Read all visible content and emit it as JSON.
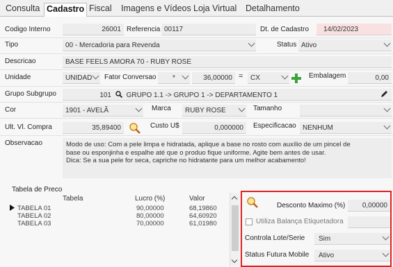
{
  "tabs": [
    "Consulta",
    "Cadastro",
    "Fiscal",
    "Imagens e Vídeos",
    "Loja Virtual",
    "Detalhamento"
  ],
  "active_tab": "Cadastro",
  "form": {
    "codigo_label": "Codigo Interno",
    "codigo_value": "26001",
    "referencia_label": "Referencia",
    "referencia_value": "00117",
    "dt_cadastro_label": "Dt. de Cadastro",
    "dt_cadastro_value": "14/02/2023",
    "tipo_label": "Tipo",
    "tipo_value": "00 - Mercadoria para Revenda",
    "status_label": "Status",
    "status_value": "Ativo",
    "descricao_label": "Descricao",
    "descricao_value": "BASE FEELS AMORA 70 - RUBY ROSE",
    "unidade_label": "Unidade",
    "unidade_value": "UNIDAD",
    "fator_label": "Fator Conversao",
    "fator_op": "*",
    "fator_value": "36,00000",
    "equals": "=",
    "cx_value": "CX",
    "embalagem_label": "Embalagem",
    "embalagem_value": "0,00",
    "grupo_label": "Grupo Subgrupo",
    "grupo_code": "101",
    "grupo_value": "GRUPO 1.1 -> GRUPO 1 -> DEPARTAMENTO 1",
    "cor_label": "Cor",
    "cor_value": "1901 - AVELÃ",
    "marca_label": "Marca",
    "marca_value": "RUBY ROSE",
    "tamanho_label": "Tamanho",
    "tamanho_value": "",
    "ult_compra_label": "Ult. Vl. Compra",
    "ult_compra_value": "35,89400",
    "custo_label": "Custo U$",
    "custo_value": "0,000000",
    "especificacao_label": "Especificacao",
    "especificacao_value": "NENHUM",
    "observacao_label": "Observacao",
    "observacao_lines": [
      "Modo de uso: Com a pele limpa e hidratada, aplique a base no rosto com auxílio de um pincel de",
      "base ou esponjinha e espalhe até que o produo fique uniforme. Agite bem antes de usar.",
      "Dica: Se a sua pele for seca, capriche no hidratante para um melhor acabamento!"
    ]
  },
  "price_table": {
    "title": "Tabela de Preco",
    "headers": [
      "Tabela",
      "Lucro (%)",
      "Valor"
    ],
    "rows": [
      {
        "tabela": "TABELA 01",
        "lucro": "90,00000",
        "valor": "68,19860"
      },
      {
        "tabela": "TABELA 02",
        "lucro": "80,00000",
        "valor": "64,60920"
      },
      {
        "tabela": "TABELA 03",
        "lucro": "70,00000",
        "valor": "61,01980"
      }
    ]
  },
  "side_panel": {
    "desconto_label": "Desconto Maximo (%)",
    "desconto_value": "0,00000",
    "balanca_label": "Utiliza Balança Etiquetadora",
    "lote_label": "Controla Lote/Serie",
    "lote_value": "Sim",
    "status_futura_label": "Status Futura Mobile",
    "status_futura_value": "Ativo"
  },
  "colors": {
    "highlight_border": "#e02020",
    "pink_field": "#f9e1e1",
    "plus_green": "#3aa33a"
  }
}
